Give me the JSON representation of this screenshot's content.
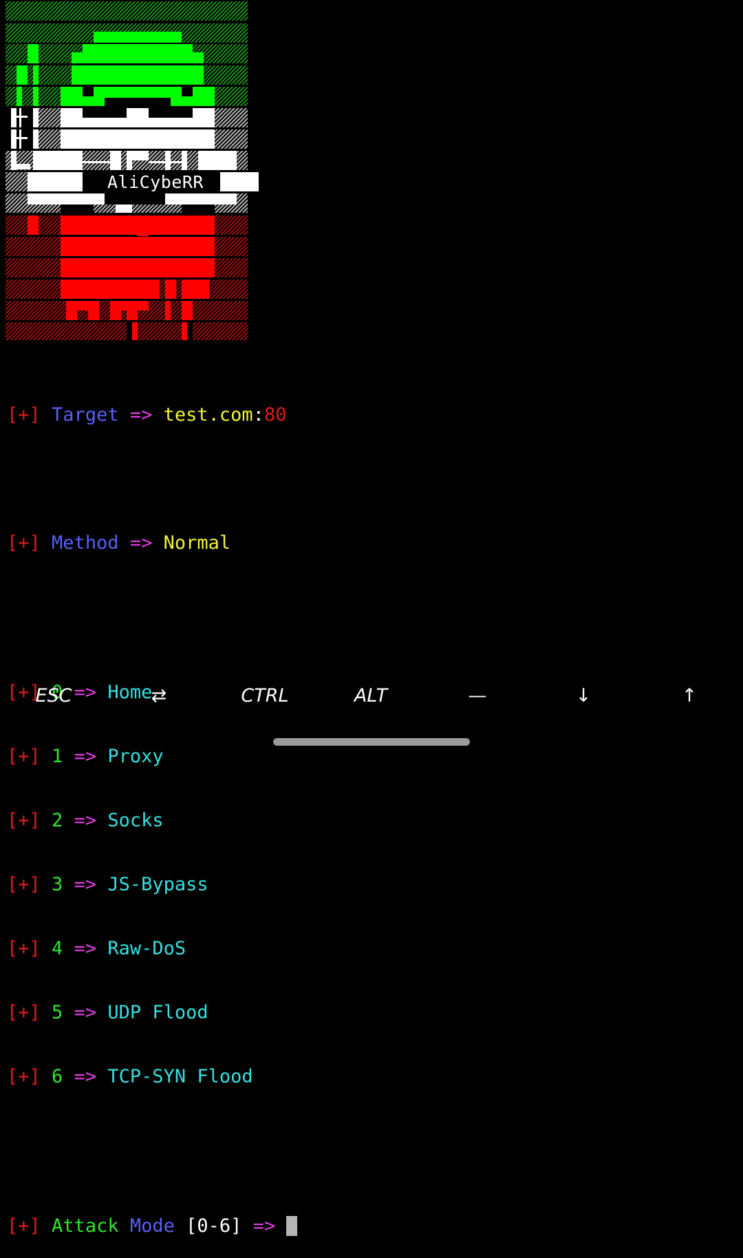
{
  "banner": {
    "label": "AliCybeRR"
  },
  "lines": {
    "target": {
      "prefix": "[+]",
      "key": "Target",
      "arrow": "=>",
      "host": "test.com",
      "colon": ":",
      "port": "80"
    },
    "method": {
      "prefix": "[+]",
      "key": "Method",
      "arrow": "=>",
      "value": "Normal"
    },
    "options": [
      {
        "prefix": "[+]",
        "num": "0",
        "arrow": "=>",
        "label": "Home"
      },
      {
        "prefix": "[+]",
        "num": "1",
        "arrow": "=>",
        "label": "Proxy"
      },
      {
        "prefix": "[+]",
        "num": "2",
        "arrow": "=>",
        "label": "Socks"
      },
      {
        "prefix": "[+]",
        "num": "3",
        "arrow": "=>",
        "label": "JS-Bypass"
      },
      {
        "prefix": "[+]",
        "num": "4",
        "arrow": "=>",
        "label": "Raw-DoS"
      },
      {
        "prefix": "[+]",
        "num": "5",
        "arrow": "=>",
        "label": "UDP Flood"
      },
      {
        "prefix": "[+]",
        "num": "6",
        "arrow": "=>",
        "label": "TCP-SYN Flood"
      }
    ],
    "prompt": {
      "prefix": "[+]",
      "word1": "Attack",
      "word2": "Mode",
      "range": "[0-6]",
      "arrow": "=>"
    }
  },
  "extra_keys": [
    "ESC",
    "⇄",
    "CTRL",
    "ALT",
    "—",
    "↓",
    "↑"
  ],
  "colors": {
    "green": "#00ff00",
    "white": "#ffffff",
    "red": "#ff0000",
    "background": "#000000"
  }
}
